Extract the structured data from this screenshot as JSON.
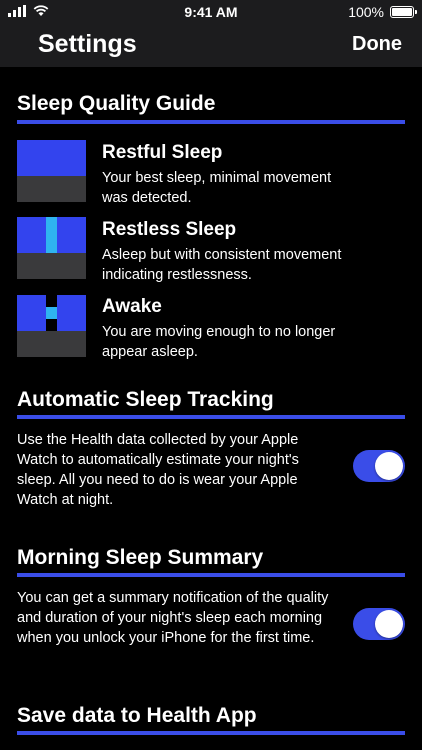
{
  "status_bar": {
    "time": "9:41 AM",
    "battery_label": "100%"
  },
  "nav": {
    "title": "Settings",
    "done_label": "Done"
  },
  "sleep_quality": {
    "header": "Sleep Quality Guide",
    "items": [
      {
        "title": "Restful Sleep",
        "desc_line1": "Your best sleep, minimal movement",
        "desc_line2": "was detected."
      },
      {
        "title": "Restless Sleep",
        "desc_line1": "Asleep but with consistent movement",
        "desc_line2": "indicating restlessness."
      },
      {
        "title": "Awake",
        "desc_line1": "You are moving enough to no longer",
        "desc_line2": "appear asleep."
      }
    ]
  },
  "auto_tracking": {
    "header": "Automatic Sleep Tracking",
    "lines": [
      "Use the Health data collected by your Apple",
      "Watch to automatically estimate your night's",
      "sleep.  All you need to do is wear your Apple",
      "Watch at night."
    ],
    "enabled": true
  },
  "morning_summary": {
    "header": "Morning Sleep Summary",
    "lines": [
      "You can get a summary notification of the quality",
      "and duration of your night's sleep each morning",
      "when you unlock your iPhone for the first time."
    ],
    "enabled": true
  },
  "health_app": {
    "header": "Save data to Health App"
  },
  "colors": {
    "accent": "#3a4de8",
    "restful": "#3344ee",
    "restless_stripe": "#2fb4f0",
    "bar_gray": "#3a3a3c"
  }
}
